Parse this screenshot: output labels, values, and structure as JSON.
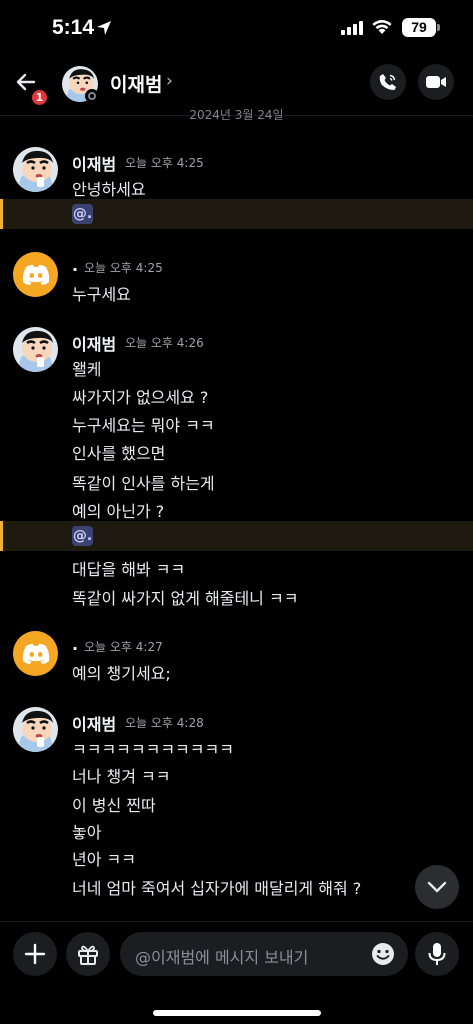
{
  "status_bar": {
    "time": "5:14",
    "battery": "79"
  },
  "header": {
    "badge": "1",
    "name": "이재범",
    "chevron": "›"
  },
  "date_separator": "2024년 3월 24일",
  "messages": [
    {
      "author": "이재범",
      "timestamp": "오늘 오후 4:25",
      "avatar": "shinchan-avatar",
      "lines": [
        "안녕하세요"
      ],
      "mention": "@."
    },
    {
      "author": ".",
      "timestamp": "오늘 오후 4:25",
      "avatar": "discord-avatar",
      "lines": [
        "누구세요"
      ]
    },
    {
      "author": "이재범",
      "timestamp": "오늘 오후 4:26",
      "avatar": "shinchan-avatar",
      "lines": [
        "왤케",
        "싸가지가 없으세요 ?",
        "누구세요는 뭐야 ㅋㅋ",
        "인사를 했으면",
        "똑같이 인사를 하는게",
        "예의 아닌가 ?"
      ],
      "mention": "@.",
      "lines_after": [
        "대답을 해봐 ㅋㅋ",
        "똑같이 싸가지 없게 해줄테니 ㅋㅋ"
      ]
    },
    {
      "author": ".",
      "timestamp": "오늘 오후 4:27",
      "avatar": "discord-avatar",
      "lines": [
        "예의 챙기세요;"
      ]
    },
    {
      "author": "이재범",
      "timestamp": "오늘 오후 4:28",
      "avatar": "shinchan-avatar",
      "lines": [
        "ㅋㅋㅋㅋㅋㅋㅋㅋㅋㅋㅋ",
        "너나 챙겨 ㅋㅋ",
        "이 병신 찐따",
        "놓아",
        "년아 ㅋㅋ",
        "너네 엄마 죽여서 십자가에 매달리게 해줘 ?"
      ]
    }
  ],
  "composer": {
    "placeholder": "@이재범에 메시지 보내기"
  },
  "colors": {
    "background": "#000000",
    "mention_highlight": "#f0b232",
    "discord_avatar": "#f5a623",
    "badge": "#e1363b"
  }
}
